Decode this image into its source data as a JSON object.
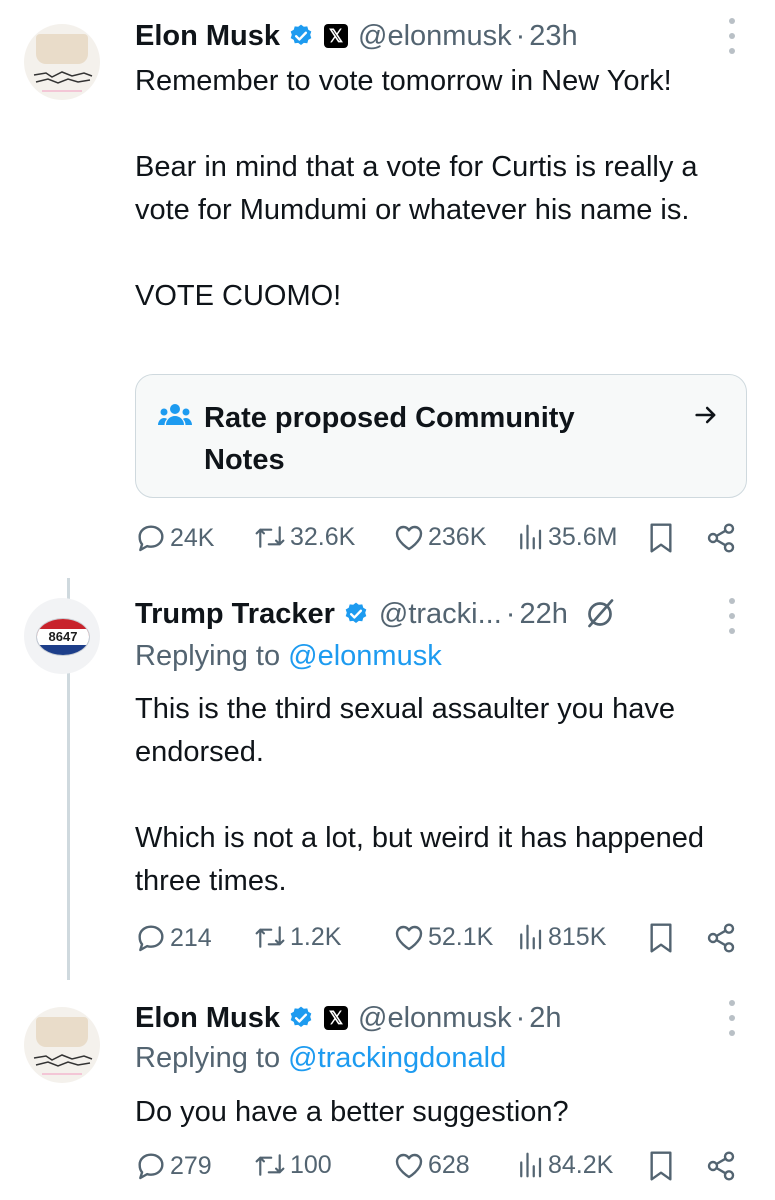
{
  "tweets": [
    {
      "name": "Elon Musk",
      "handle": "@elonmusk",
      "time": "23h",
      "body": [
        "Remember to vote tomorrow in New York!",
        "",
        "Bear in mind that a vote for Curtis is really a vote for Mumdumi or whatever his name is.",
        "",
        "VOTE CUOMO!"
      ],
      "community_note": "Rate proposed Community Notes",
      "stats": {
        "replies": "24K",
        "reposts": "32.6K",
        "likes": "236K",
        "views": "35.6M"
      }
    },
    {
      "name": "Trump Tracker",
      "handle": "@tracki...",
      "time": "22h",
      "avatar_text": "8647",
      "replying_label": "Replying to",
      "replying_to": "@elonmusk",
      "body": [
        "This is the third sexual assaulter you have endorsed.",
        "",
        "Which is not a lot, but weird it has happened three times."
      ],
      "stats": {
        "replies": "214",
        "reposts": "1.2K",
        "likes": "52.1K",
        "views": "815K"
      }
    },
    {
      "name": "Elon Musk",
      "handle": "@elonmusk",
      "time": "2h",
      "replying_label": "Replying to",
      "replying_to": "@trackingdonald",
      "body": [
        "Do you have a better suggestion?"
      ],
      "stats": {
        "replies": "279",
        "reposts": "100",
        "likes": "628",
        "views": "84.2K"
      }
    }
  ],
  "separator": "·",
  "colors": {
    "verified": "#1d9bf0",
    "link": "#1d9bf0",
    "muted": "#536471",
    "text": "#0f1419"
  },
  "icons": {
    "verified": "verified-badge-icon",
    "x": "x-logo-icon",
    "more": "more-options-icon",
    "grok": "grok-icon",
    "people": "community-notes-icon",
    "arrow": "arrow-right-icon",
    "reply": "reply-icon",
    "repost": "repost-icon",
    "like": "like-icon",
    "views": "views-icon",
    "bookmark": "bookmark-icon",
    "share": "share-icon"
  }
}
